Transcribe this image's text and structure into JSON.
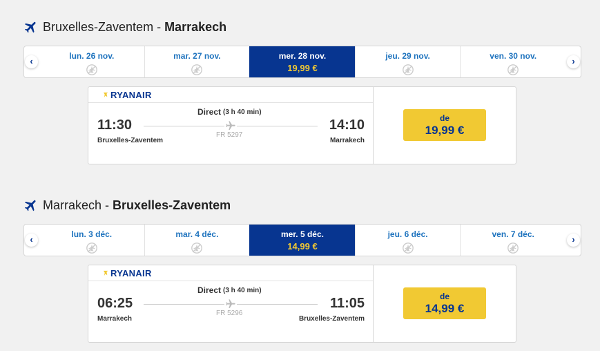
{
  "outbound": {
    "route": {
      "from": "Bruxelles-Zaventem",
      "separator": "-",
      "to": "Marrakech"
    },
    "dates": [
      {
        "label": "lun. 26 nov.",
        "price": "",
        "selected": false
      },
      {
        "label": "mar. 27 nov.",
        "price": "",
        "selected": false
      },
      {
        "label": "mer. 28 nov.",
        "price": "19,99 €",
        "selected": true
      },
      {
        "label": "jeu. 29 nov.",
        "price": "",
        "selected": false
      },
      {
        "label": "ven. 30 nov.",
        "price": "",
        "selected": false
      }
    ],
    "flight": {
      "airline": "RYANAIR",
      "dep_time": "11:30",
      "arr_time": "14:10",
      "dep_city": "Bruxelles-Zaventem",
      "arr_city": "Marrakech",
      "type": "Direct",
      "duration": "(3 h 40 min)",
      "flight_no": "FR 5297",
      "price_prefix": "de",
      "price": "19,99 €"
    }
  },
  "return": {
    "route": {
      "from": "Marrakech",
      "separator": "-",
      "to": "Bruxelles-Zaventem"
    },
    "dates": [
      {
        "label": "lun. 3 déc.",
        "price": "",
        "selected": false
      },
      {
        "label": "mar. 4 déc.",
        "price": "",
        "selected": false
      },
      {
        "label": "mer. 5 déc.",
        "price": "14,99 €",
        "selected": true
      },
      {
        "label": "jeu. 6 déc.",
        "price": "",
        "selected": false
      },
      {
        "label": "ven. 7 déc.",
        "price": "",
        "selected": false
      }
    ],
    "flight": {
      "airline": "RYANAIR",
      "dep_time": "06:25",
      "arr_time": "11:05",
      "dep_city": "Marrakech",
      "arr_city": "Bruxelles-Zaventem",
      "type": "Direct",
      "duration": "(3 h 40 min)",
      "flight_no": "FR 5296",
      "price_prefix": "de",
      "price": "14,99 €"
    }
  },
  "nav": {
    "prev": "‹",
    "next": "›"
  },
  "icons": {
    "route": "airplane-icon",
    "no_flight": "no-flight-icon",
    "logo": "ryanair-harp-logo"
  },
  "colors": {
    "brand_blue": "#073590",
    "link_blue": "#1e73be",
    "price_yellow": "#f1c933"
  }
}
